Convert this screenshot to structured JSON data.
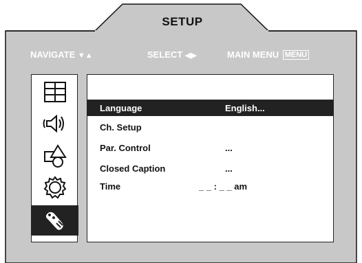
{
  "header": {
    "title": "SETUP"
  },
  "nav": {
    "navigate_label": "NAVIGATE",
    "navigate_arrows": "▼▲",
    "select_label": "SELECT",
    "select_arrows": "◀▶",
    "main_menu_label": "MAIN MENU",
    "menu_badge": "MENU"
  },
  "sidebar": {
    "icons": [
      {
        "name": "display-grid-icon",
        "selected": false
      },
      {
        "name": "speaker-icon",
        "selected": false
      },
      {
        "name": "shapes-icon",
        "selected": false
      },
      {
        "name": "settings-gear-icon",
        "selected": false
      },
      {
        "name": "tools-connector-icon",
        "selected": true
      }
    ]
  },
  "menu": {
    "items": [
      {
        "label": "Language",
        "value": "English...",
        "selected": true
      },
      {
        "label": "Ch. Setup",
        "value": "",
        "selected": false
      },
      {
        "label": "Par. Control",
        "value": "...",
        "selected": false
      },
      {
        "label": "Closed Caption",
        "value": "...",
        "selected": false
      },
      {
        "label": "Time",
        "value": "_ _ : _ _ am",
        "selected": false
      }
    ]
  },
  "colors": {
    "frame_gray": "#c8c8c8",
    "selected_bg": "#222222",
    "text_white": "#ffffff"
  }
}
